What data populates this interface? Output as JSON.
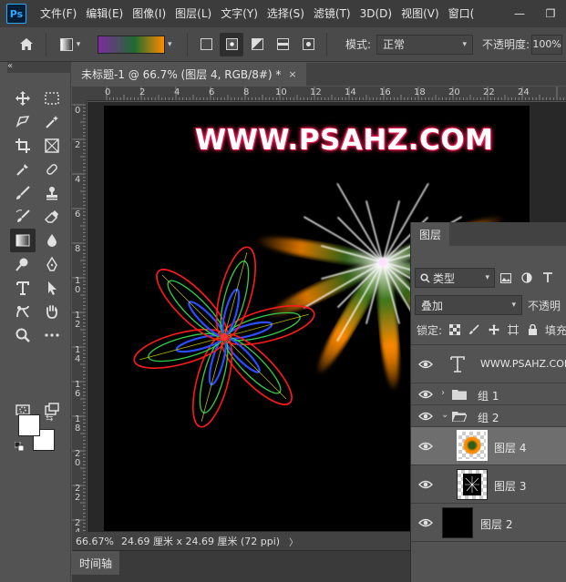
{
  "menu": {
    "items": [
      "文件(F)",
      "编辑(E)",
      "图像(I)",
      "图层(L)",
      "文字(Y)",
      "选择(S)",
      "滤镜(T)",
      "3D(D)",
      "视图(V)",
      "窗口("
    ],
    "logo": "Ps"
  },
  "window_controls": {
    "minimize": "—",
    "restore": "❐"
  },
  "options": {
    "mode_label": "模式:",
    "mode_value": "正常",
    "opacity_label": "不透明度:",
    "opacity_value": "100%"
  },
  "document": {
    "tab_title": "未标题-1 @ 66.7% (图层 4, RGB/8#) *",
    "close": "×"
  },
  "rulers": {
    "horizontal": [
      "0",
      "2",
      "4",
      "6",
      "8",
      "10",
      "12",
      "14",
      "16",
      "18",
      "20",
      "22",
      "24"
    ],
    "vertical": [
      "0",
      "2",
      "4",
      "6",
      "8",
      "1\n0",
      "1\n2",
      "1\n4",
      "1\n6",
      "1\n8",
      "2\n0",
      "2\n2",
      "2\n4"
    ]
  },
  "canvas": {
    "watermark_text": "WWW.PSAHZ.COM",
    "background": "#000000"
  },
  "status": {
    "zoom": "66.67%",
    "doc_size": "24.69 厘米 x 24.69 厘米 (72 ppi)",
    "arrow": "〉"
  },
  "timeline": {
    "tab": "时间轴"
  },
  "layers_panel": {
    "tab": "图层",
    "filter_type": "类型",
    "blend_mode": "叠加",
    "opacity_label": "不透明",
    "lock_label": "锁定:",
    "fill_label": "填充",
    "layers": [
      {
        "name": "WWW.PSAHZ.COM",
        "kind": "text",
        "visible": true,
        "selected": false
      },
      {
        "name": "组 1",
        "kind": "group",
        "expanded": false,
        "visible": true,
        "selected": false
      },
      {
        "name": "组 2",
        "kind": "group",
        "expanded": true,
        "visible": true,
        "selected": false
      },
      {
        "name": "图层 4",
        "kind": "pixel",
        "visible": true,
        "selected": true,
        "thumb": "orange-green-blur"
      },
      {
        "name": "图层 3",
        "kind": "pixel",
        "visible": true,
        "selected": false,
        "thumb": "white-burst"
      },
      {
        "name": "图层 2",
        "kind": "pixel",
        "visible": true,
        "selected": false,
        "thumb": "black-fill"
      }
    ]
  },
  "colors": {
    "foreground": "#ffffff",
    "background": "#ffffff",
    "accent": "#31a8ff",
    "selected_row": "#6e6e6e"
  }
}
